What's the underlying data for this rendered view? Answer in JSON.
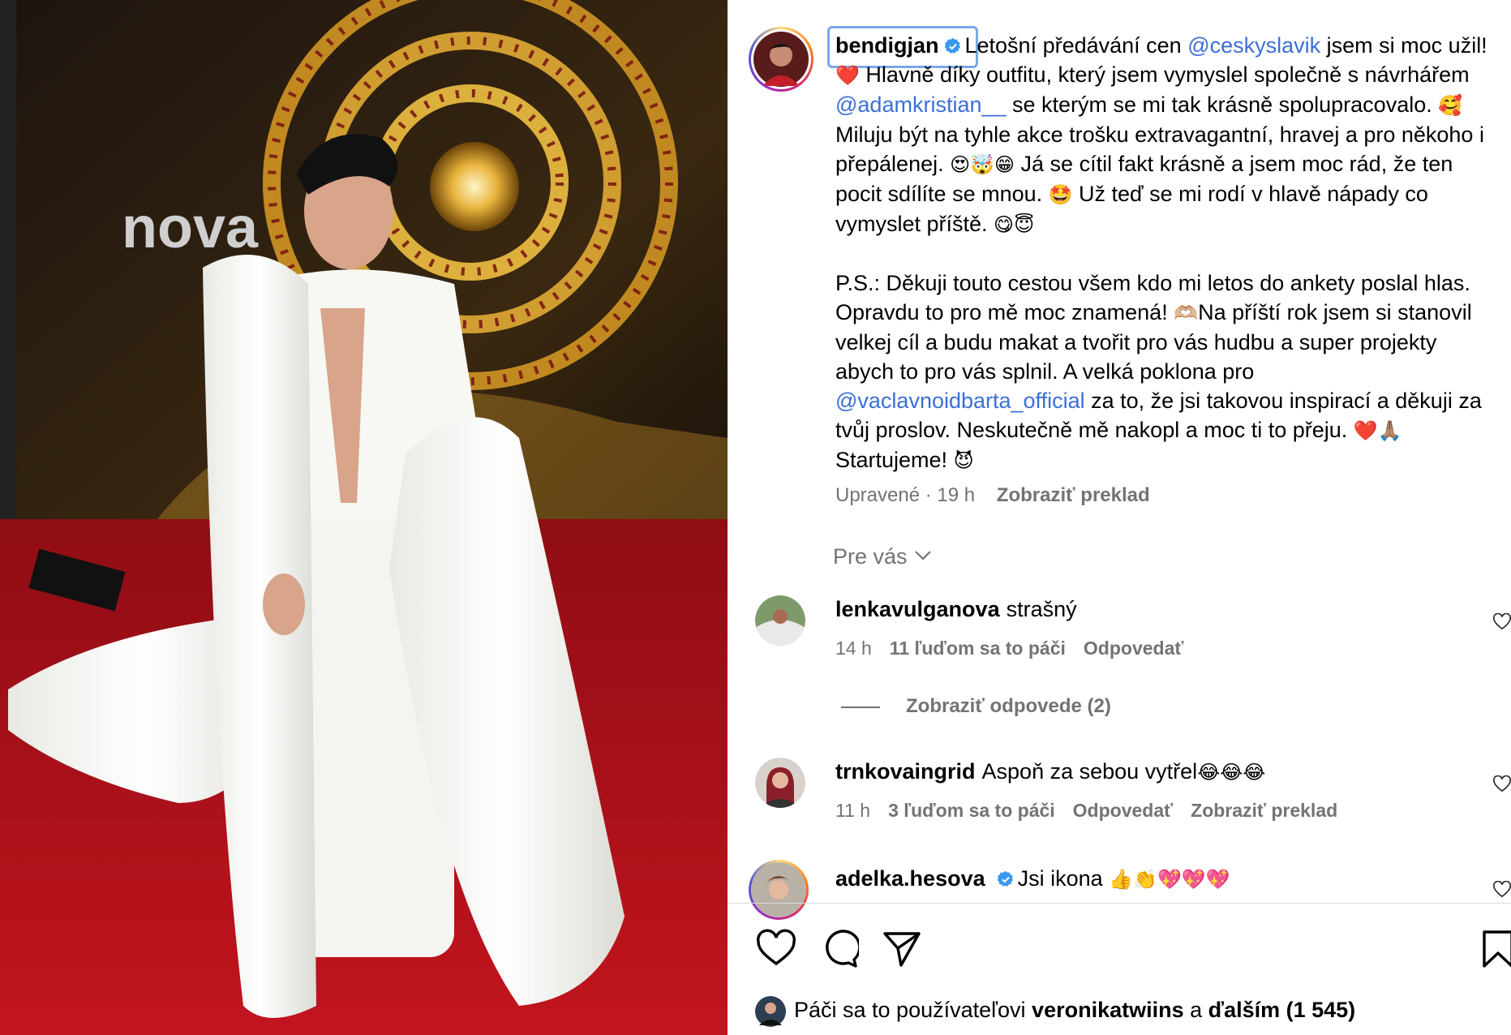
{
  "post": {
    "author": "bendigjan",
    "caption": {
      "p1_a": "Letošní předávání cen ",
      "mention1": "@ceskyslavik",
      "p1_b": " jsem si moc užil! ",
      "emoji1": "❤️",
      "p1_c": " Hlavně díky outfitu, který jsem vymyslel společně s návrhářem ",
      "mention2": "@adamkristian__",
      "p1_d": " se kterým se mi tak krásně spolupracovalo. ",
      "emoji2": "🥰",
      "p1_e": " Miluju být na tyhle akce trošku extravagantní, hravej a pro někoho i přepálenej. ",
      "emoji3": "😍🤯😁",
      "p1_f": " Já se cítil fakt krásně a jsem moc rád, že ten pocit sdílíte se mnou. ",
      "emoji4": "🤩",
      "p1_g": " Už teď se mi rodí v hlavě nápady co vymyslet příště. ",
      "emoji5": "😋😇",
      "p2_a": "P.S.: Děkuji touto cestou všem kdo mi letos do ankety poslal hlas. Opravdu to pro mě moc znamená! ",
      "emoji6": "🫶🏼",
      "p2_b": "Na příští rok jsem si stanovil velkej cíl a budu makat a tvořit pro vás hudbu a super projekty abych to pro vás splnil. A velká poklona pro ",
      "mention3": "@vaclavnoidbarta_official",
      "p2_c": " za to, že jsi takovou inspirací a děkuji za tvůj proslov. Neskutečně mě nakopl a moc ti to přeju. ",
      "emoji7": "❤️🙏🏽",
      "p2_d": " Startujeme! ",
      "emoji8": "😈"
    },
    "edited_label": "Upravené",
    "time": "19 h",
    "translate_label": "Zobraziť preklad"
  },
  "photo": {
    "backdrop_brand": "nova"
  },
  "sort_label": "Pre vás",
  "comments": [
    {
      "user": "lenkavulganova",
      "text": "strašný",
      "time": "14 h",
      "likes": "11 ľuďom sa to páči",
      "reply": "Odpovedať",
      "translate": ""
    },
    {
      "user": "trnkovaingrid",
      "text": "Aspoň za sebou vytřel",
      "emoji": "😂😂😂",
      "time": "11 h",
      "likes": "3 ľuďom sa to páči",
      "reply": "Odpovedať",
      "translate": "Zobraziť preklad"
    },
    {
      "user": "adelka.hesova",
      "text": "Jsi ikona",
      "emoji": "👍👏💖💖💖"
    }
  ],
  "view_replies": "Zobraziť odpovede (2)",
  "likes_bar": {
    "prefix": "Páči sa to používateľovi ",
    "user": "veronikatwiins",
    "middle": " a ",
    "others": "ďalším (1 545)"
  },
  "colors": {
    "link": "#3b6fd8",
    "muted": "#737373",
    "verified": "#3897f0",
    "carpet": "#b5121b"
  }
}
